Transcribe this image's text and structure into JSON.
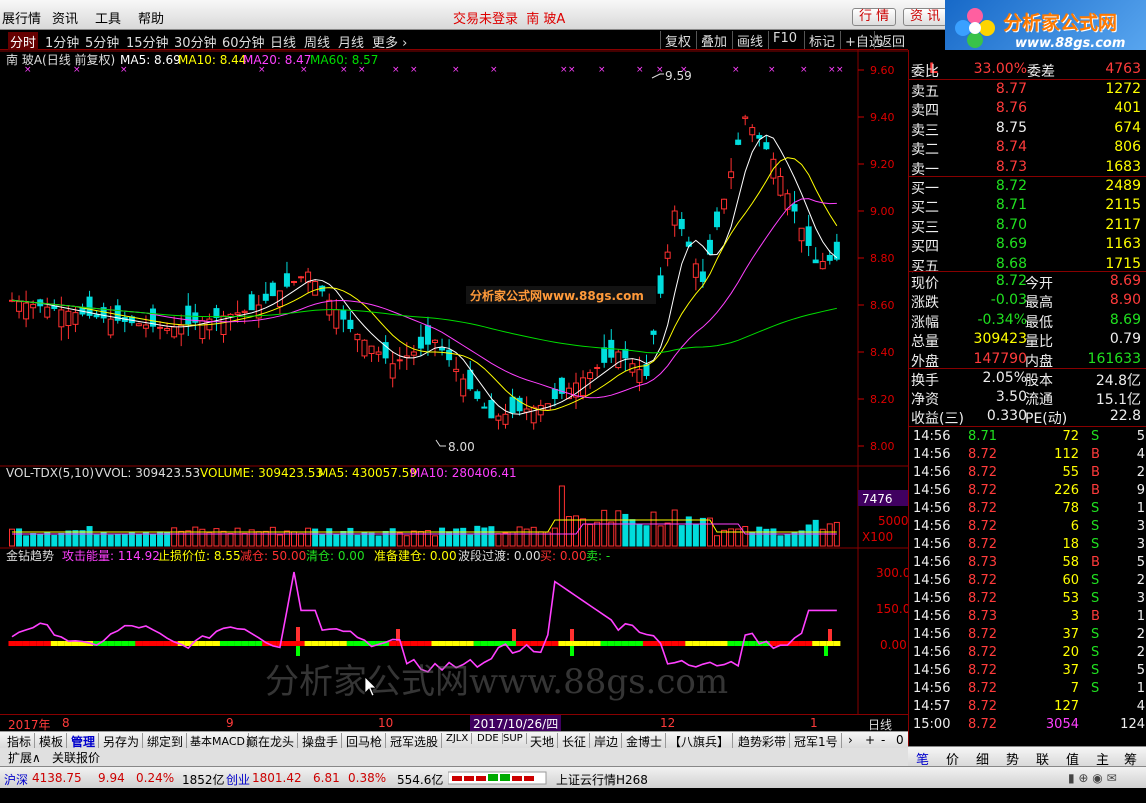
{
  "menubar": {
    "items": [
      "展行情",
      "资讯",
      "工具",
      "帮助"
    ],
    "center_status": "交易未登录",
    "center_stock": "南 玻A",
    "btn_quote": "行 情",
    "btn_info": "资 讯"
  },
  "logo": {
    "name": "分析家公式网",
    "url": "www.88gs.com"
  },
  "toolbar": {
    "periods": [
      "分时",
      "1分钟",
      "5分钟",
      "15分钟",
      "30分钟",
      "60分钟",
      "日线",
      "周线",
      "月线",
      "更多 ›"
    ],
    "right_buttons": [
      "复权",
      "叠加",
      "画线",
      "F10",
      "标记",
      "+自选",
      "返回"
    ]
  },
  "main_chart": {
    "legend_name": "南 玻A(日线 前复权)",
    "ma5": "MA5: 8.69",
    "ma10": "MA10: 8.44",
    "ma20": "MA20: 8.47",
    "ma60": "MA60: 8.57",
    "price_ticks": [
      "9.60",
      "9.40",
      "9.20",
      "9.00",
      "8.80",
      "8.60",
      "8.40",
      "8.20",
      "8.00"
    ],
    "high_label": "9.59",
    "low_label": "8.00",
    "watermark": "分析家公式网www.88gs.com",
    "colors": {
      "up": "#ff3030",
      "down": "#00dddd",
      "ma5": "#ffffff",
      "ma10": "#ffff00",
      "ma20": "#ff40ff",
      "ma60": "#00dd00"
    }
  },
  "volume_chart": {
    "legend_name": "VOL-TDX(5,10)",
    "vvol": "VVOL: 309423.53",
    "volume": "VOLUME: 309423.53",
    "ma5": "MA5: 430057.59",
    "ma10": "MA10: 280406.41",
    "ticks": [
      "7476",
      "5000",
      "X100"
    ]
  },
  "indicator_chart": {
    "name": "金钻趋势",
    "attack": "攻击能量: 114.92",
    "stop": "止损价位: 8.55",
    "reduce": "减仓: 50.00",
    "clear": "清仓: 0.00",
    "prepare": "准备建仓: 0.00",
    "wave": "波段过渡: 0.00",
    "buy": "买: 0.00",
    "sell": "卖: -",
    "ticks": [
      "300.0",
      "150.0",
      "0.00"
    ],
    "watermark": "分析家公式网www.88gs.com"
  },
  "date_axis": {
    "labels": [
      "2017年",
      "8",
      "9",
      "10",
      "12",
      "1"
    ],
    "selected_date": "2017/10/26/四",
    "period_label": "日线"
  },
  "function_tabs": [
    "指标",
    "模板",
    "管理",
    "另存为",
    "绑定到",
    "基本MACD",
    "巅在龙头",
    "操盘手",
    "回马枪",
    "冠军选股",
    "ZJLX",
    "DDE",
    "SUP",
    "天地",
    "长征",
    "岸边",
    "金博士",
    "【八旗兵】",
    "趋势彩带",
    "冠军1号"
  ],
  "ext_tabs": [
    "扩展∧",
    "关联报价"
  ],
  "quote": {
    "code_tag": "L",
    "weibi_label": "委比",
    "weibi_val": "33.00%",
    "weicha_label": "委差",
    "weicha_val": "4763",
    "asks": [
      {
        "label": "卖五",
        "price": "8.77",
        "vol": "1272"
      },
      {
        "label": "卖四",
        "price": "8.76",
        "vol": "401"
      },
      {
        "label": "卖三",
        "price": "8.75",
        "vol": "674"
      },
      {
        "label": "卖二",
        "price": "8.74",
        "vol": "806"
      },
      {
        "label": "卖一",
        "price": "8.73",
        "vol": "1683"
      }
    ],
    "bids": [
      {
        "label": "买一",
        "price": "8.72",
        "vol": "2489"
      },
      {
        "label": "买二",
        "price": "8.71",
        "vol": "2115"
      },
      {
        "label": "买三",
        "price": "8.70",
        "vol": "2117"
      },
      {
        "label": "买四",
        "price": "8.69",
        "vol": "1163"
      },
      {
        "label": "买五",
        "price": "8.68",
        "vol": "1715"
      }
    ],
    "stats": [
      {
        "l1": "现价",
        "v1": "8.72",
        "l2": "今开",
        "v2": "8.69"
      },
      {
        "l1": "涨跌",
        "v1": "-0.03",
        "l2": "最高",
        "v2": "8.90"
      },
      {
        "l1": "涨幅",
        "v1": "-0.34%",
        "l2": "最低",
        "v2": "8.69"
      },
      {
        "l1": "总量",
        "v1": "309423",
        "l2": "量比",
        "v2": "0.79"
      },
      {
        "l1": "外盘",
        "v1": "147790",
        "l2": "内盘",
        "v2": "161633"
      }
    ],
    "fin": [
      {
        "l1": "换手",
        "v1": "2.05%",
        "l2": "股本",
        "v2": "24.8亿"
      },
      {
        "l1": "净资",
        "v1": "3.50",
        "l2": "流通",
        "v2": "15.1亿"
      },
      {
        "l1": "收益(三)",
        "v1": "0.330",
        "l2": "PE(动)",
        "v2": "22.8"
      }
    ],
    "ticks": [
      {
        "t": "14:56",
        "p": "8.71",
        "v": "72",
        "bs": "S",
        "n": "5"
      },
      {
        "t": "14:56",
        "p": "8.72",
        "v": "112",
        "bs": "B",
        "n": "4"
      },
      {
        "t": "14:56",
        "p": "8.72",
        "v": "55",
        "bs": "B",
        "n": "2"
      },
      {
        "t": "14:56",
        "p": "8.72",
        "v": "226",
        "bs": "B",
        "n": "9"
      },
      {
        "t": "14:56",
        "p": "8.72",
        "v": "78",
        "bs": "S",
        "n": "1"
      },
      {
        "t": "14:56",
        "p": "8.72",
        "v": "6",
        "bs": "S",
        "n": "3"
      },
      {
        "t": "14:56",
        "p": "8.72",
        "v": "18",
        "bs": "S",
        "n": "3"
      },
      {
        "t": "14:56",
        "p": "8.73",
        "v": "58",
        "bs": "B",
        "n": "5"
      },
      {
        "t": "14:56",
        "p": "8.72",
        "v": "60",
        "bs": "S",
        "n": "2"
      },
      {
        "t": "14:56",
        "p": "8.72",
        "v": "53",
        "bs": "S",
        "n": "3"
      },
      {
        "t": "14:56",
        "p": "8.73",
        "v": "3",
        "bs": "B",
        "n": "1"
      },
      {
        "t": "14:56",
        "p": "8.72",
        "v": "37",
        "bs": "S",
        "n": "2"
      },
      {
        "t": "14:56",
        "p": "8.72",
        "v": "20",
        "bs": "S",
        "n": "2"
      },
      {
        "t": "14:56",
        "p": "8.72",
        "v": "37",
        "bs": "S",
        "n": "5"
      },
      {
        "t": "14:56",
        "p": "8.72",
        "v": "7",
        "bs": "S",
        "n": "1"
      },
      {
        "t": "14:57",
        "p": "8.72",
        "v": "127",
        "bs": "",
        "n": "4"
      },
      {
        "t": "15:00",
        "p": "8.72",
        "v": "3054",
        "bs": "",
        "n": "124"
      }
    ]
  },
  "side_tabs": [
    "笔",
    "价",
    "细",
    "势",
    "联",
    "值",
    "主",
    "筹"
  ],
  "statusbar": {
    "sh_label": "沪深",
    "sh_val": "4138.75",
    "sh_chg": "9.94",
    "sh_pct": "0.24%",
    "sh_amt": "1852亿",
    "cy_label": "创业",
    "cy_val": "1801.42",
    "cy_chg": "6.81",
    "cy_pct": "0.38%",
    "cy_amt": "554.6亿",
    "server": "上证云行情H268"
  }
}
